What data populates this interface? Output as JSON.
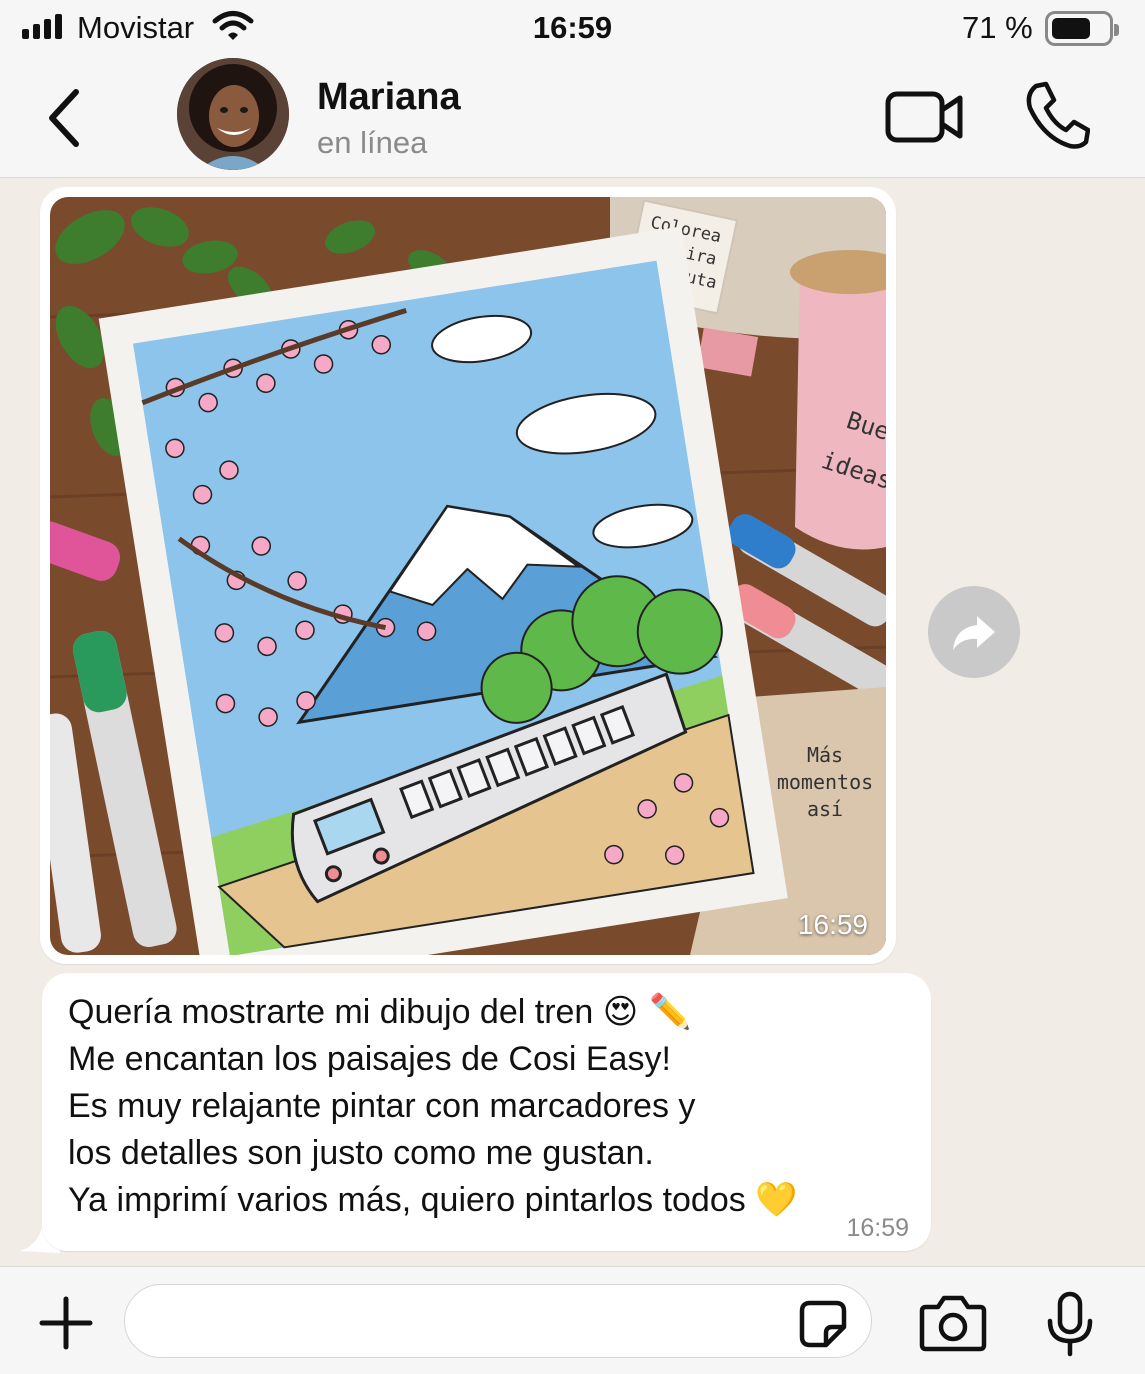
{
  "status_bar": {
    "carrier": "Movistar",
    "time": "16:59",
    "battery_percent": "71 %",
    "battery_level": 0.71
  },
  "header": {
    "contact_name": "Mariana",
    "contact_status": "en línea",
    "icons": [
      "chevron-left-icon",
      "video-camera-icon",
      "phone-icon"
    ]
  },
  "image_message": {
    "time": "16:59",
    "tag_text": [
      "Colorea",
      "Respira",
      "Disfruta"
    ],
    "mug_text": [
      "Buenas",
      "ideas"
    ],
    "notebook_text": [
      "Más",
      "momentos",
      "así"
    ]
  },
  "text_message": {
    "lines": [
      "Quería mostrarte mi dibujo del tren",
      "Me encantan los paisajes de Cosi Easy!",
      "Es muy relajante pintar con marcadores y",
      "los detalles son justo como me gustan.",
      "Ya imprimí varios más, quiero pintarlos todos"
    ],
    "emoji_line1": "😍 ✏️",
    "emoji_line5": "💛",
    "time": "16:59"
  },
  "input_bar": {
    "placeholder": "",
    "icons": [
      "plus-icon",
      "sticker-icon",
      "camera-icon",
      "microphone-icon"
    ]
  },
  "colors": {
    "bar_background": "#f6f6f6",
    "chat_background": "#f1ede6",
    "bubble": "#ffffff",
    "muted_text": "#8a8a8a"
  }
}
